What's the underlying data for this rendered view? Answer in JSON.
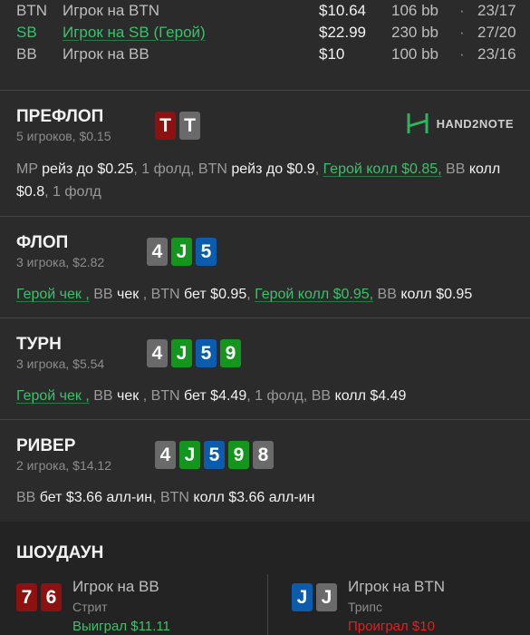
{
  "players": [
    {
      "pos": "BTN",
      "name": "Игрок на BTN",
      "stack": "$10.64",
      "bb": "106 bb",
      "sep": "·",
      "cards": "23/17",
      "hero": false
    },
    {
      "pos": "SB",
      "name": "Игрок на SB (Герой)",
      "stack": "$22.99",
      "bb": "230 bb",
      "sep": "·",
      "cards": "27/20",
      "hero": true
    },
    {
      "pos": "BB",
      "name": "Игрок на BB",
      "stack": "$10",
      "bb": "100 bb",
      "sep": "·",
      "cards": "23/16",
      "hero": false
    }
  ],
  "colors": {
    "hero": "#39c26a",
    "loss": "#e02020",
    "card_red": "#8e1111",
    "card_grey": "#6a6a6a",
    "card_green": "#14961e",
    "card_blue": "#0b5cad"
  },
  "preflop": {
    "title": "ПРЕФЛОП",
    "sub": "5 игроков, $0.15",
    "cards": [
      {
        "v": "T",
        "c": "red"
      },
      {
        "v": "T",
        "c": "grey"
      }
    ],
    "brand": "HAND2NOTE",
    "actions": [
      {
        "t": "MP ",
        "k": "n"
      },
      {
        "t": "рейз до $0.25",
        "k": "a"
      },
      {
        "t": ", 1 фолд, BTN ",
        "k": "n"
      },
      {
        "t": "рейз до $0.9",
        "k": "a"
      },
      {
        "t": ", ",
        "k": "n"
      },
      {
        "t": "Герой колл $0.85,",
        "k": "h"
      },
      {
        "t": " BB ",
        "k": "n"
      },
      {
        "t": "колл $0.8",
        "k": "a"
      },
      {
        "t": ", 1 фолд",
        "k": "n"
      }
    ]
  },
  "flop": {
    "title": "ФЛОП",
    "sub": "3 игрока, $2.82",
    "cards": [
      {
        "v": "4",
        "c": "grey"
      },
      {
        "v": "J",
        "c": "green"
      },
      {
        "v": "5",
        "c": "blue"
      }
    ],
    "actions": [
      {
        "t": "Герой чек ,",
        "k": "h"
      },
      {
        "t": " BB ",
        "k": "n"
      },
      {
        "t": "чек",
        "k": "a"
      },
      {
        "t": " , BTN ",
        "k": "n"
      },
      {
        "t": "бет $0.95",
        "k": "a"
      },
      {
        "t": ", ",
        "k": "n"
      },
      {
        "t": "Герой колл $0.95,",
        "k": "h"
      },
      {
        "t": " BB ",
        "k": "n"
      },
      {
        "t": "колл $0.95",
        "k": "a"
      }
    ]
  },
  "turn": {
    "title": "ТУРН",
    "sub": "3 игрока, $5.54",
    "cards": [
      {
        "v": "4",
        "c": "grey"
      },
      {
        "v": "J",
        "c": "green"
      },
      {
        "v": "5",
        "c": "blue"
      },
      {
        "v": "9",
        "c": "green"
      }
    ],
    "actions": [
      {
        "t": "Герой чек ,",
        "k": "h"
      },
      {
        "t": " BB ",
        "k": "n"
      },
      {
        "t": "чек",
        "k": "a"
      },
      {
        "t": " , BTN ",
        "k": "n"
      },
      {
        "t": "бет $4.49",
        "k": "a"
      },
      {
        "t": ", 1 фолд, BB ",
        "k": "n"
      },
      {
        "t": "колл $4.49",
        "k": "a"
      }
    ]
  },
  "river": {
    "title": "РИВЕР",
    "sub": "2 игрока, $14.12",
    "cards": [
      {
        "v": "4",
        "c": "grey"
      },
      {
        "v": "J",
        "c": "green"
      },
      {
        "v": "5",
        "c": "blue"
      },
      {
        "v": "9",
        "c": "green"
      },
      {
        "v": "8",
        "c": "grey"
      }
    ],
    "actions": [
      {
        "t": "BB ",
        "k": "n"
      },
      {
        "t": "бет $3.66 алл-ин",
        "k": "a"
      },
      {
        "t": ", BTN ",
        "k": "n"
      },
      {
        "t": "колл $3.66 алл-ин",
        "k": "a"
      }
    ]
  },
  "showdown": {
    "title": "ШОУДАУН",
    "players": [
      {
        "cards": [
          {
            "v": "7",
            "c": "red"
          },
          {
            "v": "6",
            "c": "red"
          }
        ],
        "name": "Игрок на BB",
        "hand": "Стрит",
        "result": "Выиграл $11.11",
        "win": true
      },
      {
        "cards": [
          {
            "v": "J",
            "c": "blue"
          },
          {
            "v": "J",
            "c": "grey"
          }
        ],
        "name": "Игрок на BTN",
        "hand": "Трипс",
        "result": "Проиграл $10",
        "win": false
      }
    ]
  }
}
